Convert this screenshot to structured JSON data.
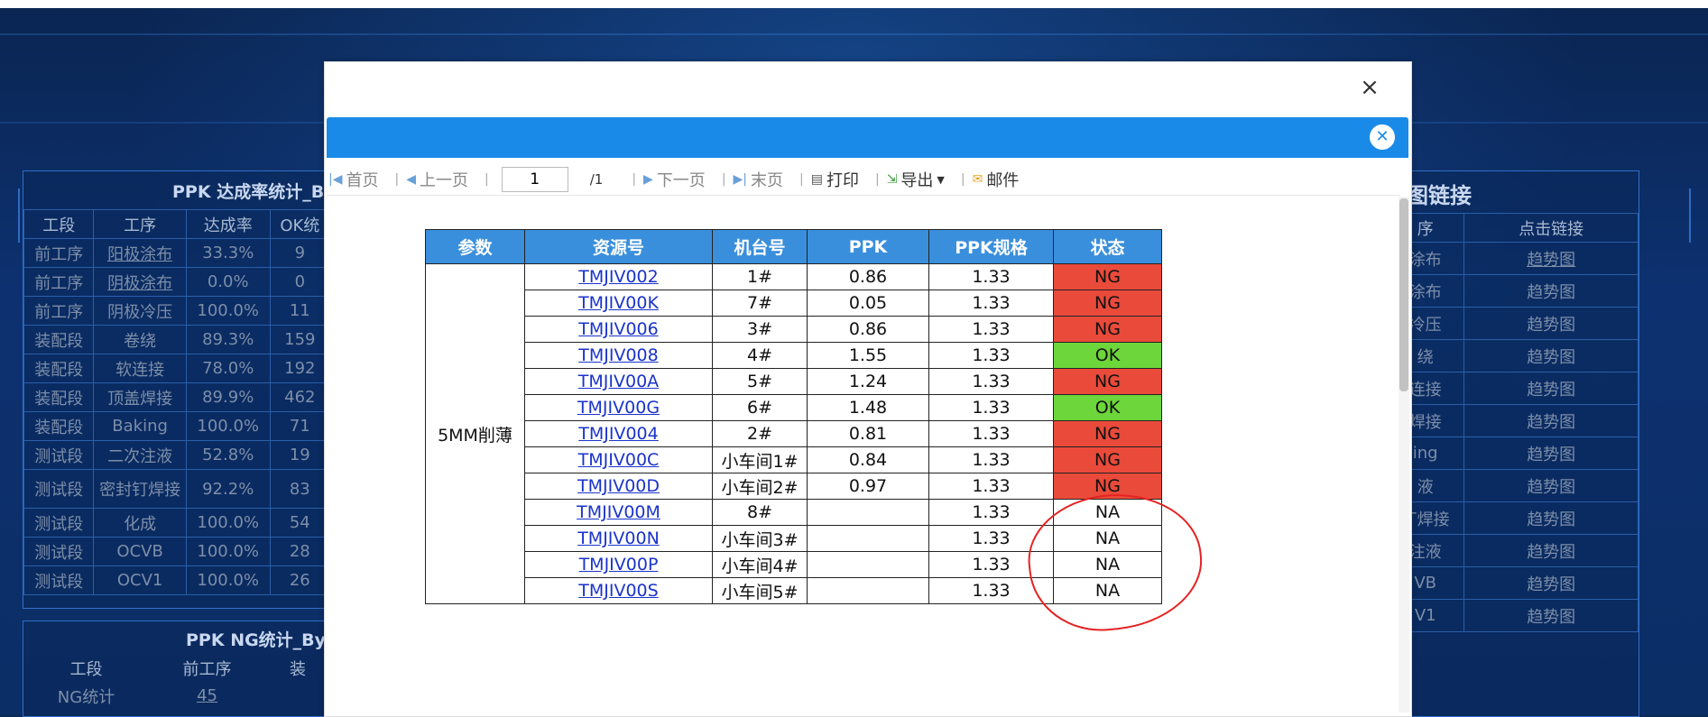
{
  "background": {
    "left_panel": {
      "title": "PPK 达成率统计_By",
      "headers": [
        "工段",
        "工序",
        "达成率",
        "OK统"
      ],
      "rows": [
        [
          "前工序",
          "阳极涂布",
          "33.3%",
          "9"
        ],
        [
          "前工序",
          "阴极涂布",
          "0.0%",
          "0"
        ],
        [
          "前工序",
          "阴极冷压",
          "100.0%",
          "11"
        ],
        [
          "装配段",
          "卷绕",
          "89.3%",
          "159"
        ],
        [
          "装配段",
          "软连接",
          "78.0%",
          "192"
        ],
        [
          "装配段",
          "顶盖焊接",
          "89.9%",
          "462"
        ],
        [
          "装配段",
          "Baking",
          "100.0%",
          "71"
        ],
        [
          "测试段",
          "二次注液",
          "52.8%",
          "19"
        ],
        [
          "测试段",
          "密封钉焊接",
          "92.2%",
          "83"
        ],
        [
          "测试段",
          "化成",
          "100.0%",
          "54"
        ],
        [
          "测试段",
          "OCVB",
          "100.0%",
          "28"
        ],
        [
          "测试段",
          "OCV1",
          "100.0%",
          "26"
        ]
      ]
    },
    "left_bottom_panel": {
      "title": "PPK NG统计_By",
      "headers": [
        "工段",
        "前工序",
        "装"
      ],
      "row": [
        "NG统计",
        "45",
        ""
      ]
    },
    "right_panel": {
      "title": "图链接",
      "headers": [
        "序",
        "点击链接"
      ],
      "rows": [
        [
          "涂布",
          "趋势图"
        ],
        [
          "涂布",
          "趋势图"
        ],
        [
          "冷压",
          "趋势图"
        ],
        [
          "绕",
          "趋势图"
        ],
        [
          "连接",
          "趋势图"
        ],
        [
          "焊接",
          "趋势图"
        ],
        [
          "ing",
          "趋势图"
        ],
        [
          "液",
          "趋势图"
        ],
        [
          "丁焊接",
          "趋势图"
        ],
        [
          "注液",
          "趋势图"
        ],
        [
          "VB",
          "趋势图"
        ],
        [
          "V1",
          "趋势图"
        ]
      ]
    }
  },
  "modal": {
    "close_symbol": "×",
    "bar_close_symbol": "✕",
    "toolbar": {
      "first": "首页",
      "prev": "上一页",
      "page_value": "1",
      "page_total": "/1",
      "next": "下一页",
      "last": "末页",
      "print": "打印",
      "export": "导出",
      "mail": "邮件"
    },
    "report": {
      "headers": [
        "参数",
        "资源号",
        "机台号",
        "PPK",
        "PPK规格",
        "状态"
      ],
      "param": "5MM削薄",
      "rows": [
        {
          "res": "TMJIV002",
          "machine": "1#",
          "ppk": "0.86",
          "spec": "1.33",
          "status": "NG"
        },
        {
          "res": "TMJIV00K",
          "machine": "7#",
          "ppk": "0.05",
          "spec": "1.33",
          "status": "NG"
        },
        {
          "res": "TMJIV006",
          "machine": "3#",
          "ppk": "0.86",
          "spec": "1.33",
          "status": "NG"
        },
        {
          "res": "TMJIV008",
          "machine": "4#",
          "ppk": "1.55",
          "spec": "1.33",
          "status": "OK"
        },
        {
          "res": "TMJIV00A",
          "machine": "5#",
          "ppk": "1.24",
          "spec": "1.33",
          "status": "NG"
        },
        {
          "res": "TMJIV00G",
          "machine": "6#",
          "ppk": "1.48",
          "spec": "1.33",
          "status": "OK"
        },
        {
          "res": "TMJIV004",
          "machine": "2#",
          "ppk": "0.81",
          "spec": "1.33",
          "status": "NG"
        },
        {
          "res": "TMJIV00C",
          "machine": "小车间1#",
          "ppk": "0.84",
          "spec": "1.33",
          "status": "NG"
        },
        {
          "res": "TMJIV00D",
          "machine": "小车间2#",
          "ppk": "0.97",
          "spec": "1.33",
          "status": "NG"
        },
        {
          "res": "TMJIV00M",
          "machine": "8#",
          "ppk": "",
          "spec": "1.33",
          "status": "NA"
        },
        {
          "res": "TMJIV00N",
          "machine": "小车间3#",
          "ppk": "",
          "spec": "1.33",
          "status": "NA"
        },
        {
          "res": "TMJIV00P",
          "machine": "小车间4#",
          "ppk": "",
          "spec": "1.33",
          "status": "NA"
        },
        {
          "res": "TMJIV00S",
          "machine": "小车间5#",
          "ppk": "",
          "spec": "1.33",
          "status": "NA"
        }
      ]
    }
  },
  "colors": {
    "header_blue": "#3a8fdc",
    "bar_blue": "#1a8ae8",
    "ng_red": "#ea4a3a",
    "ok_green": "#6dd63a",
    "annotation_red": "#e52222"
  }
}
